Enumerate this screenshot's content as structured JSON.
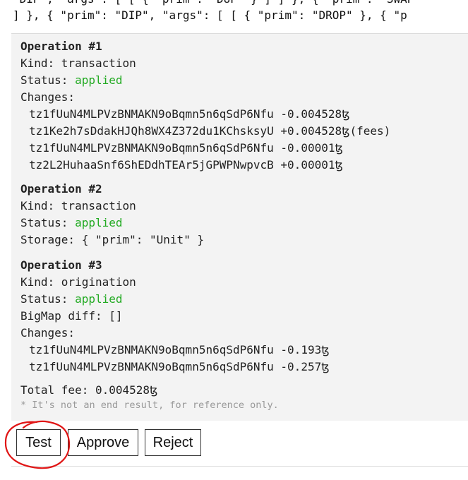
{
  "code_lines": {
    "line1": "\"DIP\", \"args\": [ [ { \"prim\": \"DUP\" } ] ] }, { \"prim\": \"SWAP\"",
    "line2": "] }, { \"prim\": \"DIP\", \"args\": [ [ { \"prim\": \"DROP\" }, { \"p"
  },
  "operations": [
    {
      "title": "Operation #1",
      "kind": "Kind: transaction",
      "status_label": "Status: ",
      "status_value": "applied",
      "changes_label": "Changes:",
      "changes": [
        "tz1fUuN4MLPVzBNMAKN9oBqmn5n6qSdP6Nfu -0.004528ꜩ",
        "tz1Ke2h7sDdakHJQh8WX4Z372du1KChsksyU +0.004528ꜩ(fees)",
        "tz1fUuN4MLPVzBNMAKN9oBqmn5n6qSdP6Nfu -0.00001ꜩ",
        "tz2L2HuhaaSnf6ShEDdhTEAr5jGPWPNwpvcB +0.00001ꜩ"
      ]
    },
    {
      "title": "Operation #2",
      "kind": "Kind: transaction",
      "status_label": "Status: ",
      "status_value": "applied",
      "storage": "Storage: { \"prim\": \"Unit\" }"
    },
    {
      "title": "Operation #3",
      "kind": "Kind: origination",
      "status_label": "Status: ",
      "status_value": "applied",
      "bigmap": "BigMap diff: []",
      "changes_label": "Changes:",
      "changes": [
        "tz1fUuN4MLPVzBNMAKN9oBqmn5n6qSdP6Nfu -0.193ꜩ",
        "tz1fUuN4MLPVzBNMAKN9oBqmn5n6qSdP6Nfu -0.257ꜩ"
      ]
    }
  ],
  "total_fee": "Total fee: 0.004528ꜩ",
  "note": "* It's not an end result, for reference only.",
  "buttons": {
    "test": "Test",
    "approve": "Approve",
    "reject": "Reject"
  },
  "colors": {
    "status_applied": "#22aa22",
    "annotation_circle": "#e01515"
  }
}
